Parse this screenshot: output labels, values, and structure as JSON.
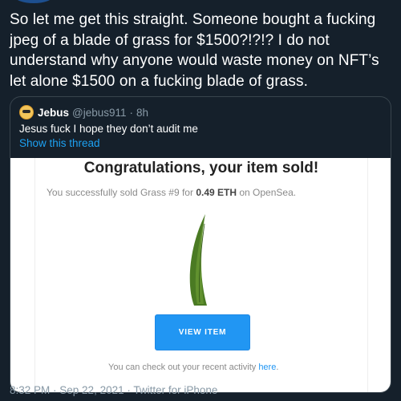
{
  "tweet": {
    "text": "So let me get this straight. Someone bought a fucking jpeg of a blade of grass for $1500?!?!? I do not understand why anyone would waste money on NFT’s let alone $1500 on a fucking blade of grass."
  },
  "quote": {
    "name": "Jebus",
    "handle": "@jebus911",
    "separator": "·",
    "time": "8h",
    "text": "Jesus fuck I hope they don’t audit me",
    "show_thread": "Show this thread"
  },
  "email": {
    "title": "Congratulations, your item sold!",
    "sub_prefix": "You successfully sold Grass #9 for ",
    "sub_amount": "0.49 ETH",
    "sub_suffix": " on OpenSea.",
    "button_label": "VIEW ITEM",
    "footer_prefix": "You can check out your recent activity ",
    "footer_link": "here",
    "footer_suffix": "."
  },
  "footer": {
    "time": "8:32 PM",
    "separator": " · ",
    "date": "Sep 22, 2021",
    "client": "Twitter for iPhone"
  },
  "colors": {
    "background": "#15202b",
    "link": "#1da1f2",
    "button": "#2196f3",
    "muted": "#8899a6",
    "grass": "#4a7a23"
  },
  "icons": {
    "quote_avatar": "avatar-emoji-icon",
    "grass": "grass-blade-icon"
  }
}
